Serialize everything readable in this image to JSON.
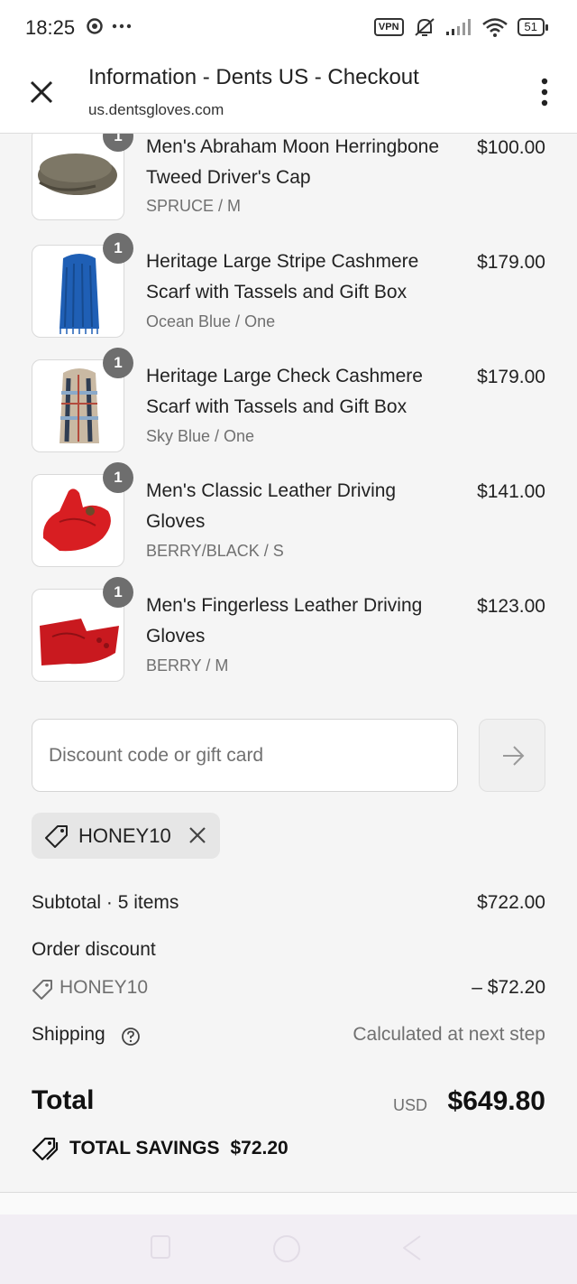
{
  "status": {
    "time": "18:25",
    "vpn": "VPN",
    "battery": "51"
  },
  "browser": {
    "title": "Information - Dents US - Checkout",
    "url": "us.dentsgloves.com"
  },
  "products": [
    {
      "title": "Men's Abraham Moon Herringbone Tweed Driver's Cap",
      "variant": "SPRUCE / M",
      "price": "$100.00",
      "qty": "1"
    },
    {
      "title": "Heritage Large Stripe Cashmere Scarf with Tassels and Gift Box",
      "variant": "Ocean Blue / One",
      "price": "$179.00",
      "qty": "1"
    },
    {
      "title": "Heritage Large Check Cashmere Scarf with Tassels and Gift Box",
      "variant": "Sky Blue / One",
      "price": "$179.00",
      "qty": "1"
    },
    {
      "title": "Men's Classic Leather Driving Gloves",
      "variant": "BERRY/BLACK / S",
      "price": "$141.00",
      "qty": "1"
    },
    {
      "title": "Men's Fingerless Leather Driving Gloves",
      "variant": "BERRY / M",
      "price": "$123.00",
      "qty": "1"
    }
  ],
  "discount": {
    "placeholder": "Discount code or gift card",
    "applied_code": "HONEY10"
  },
  "summary": {
    "subtotal_label": "Subtotal · 5 items",
    "subtotal_value": "$722.00",
    "order_discount_label": "Order discount",
    "discount_code": "HONEY10",
    "discount_value": "– $72.20",
    "shipping_label": "Shipping",
    "shipping_value": "Calculated at next step",
    "total_label": "Total",
    "currency": "USD",
    "total_value": "$649.80",
    "savings_label": "TOTAL SAVINGS",
    "savings_value": "$72.20"
  },
  "icons": {
    "close": "close-icon",
    "menu": "more-vertical-icon",
    "arrow": "arrow-right-icon",
    "tag": "tag-icon",
    "help": "question-circle-icon",
    "savings": "tags-icon"
  },
  "colors": {
    "badge": "#6e6e6e",
    "glove_red": "#d81e22",
    "scarf_blue": "#1f5fb5"
  }
}
